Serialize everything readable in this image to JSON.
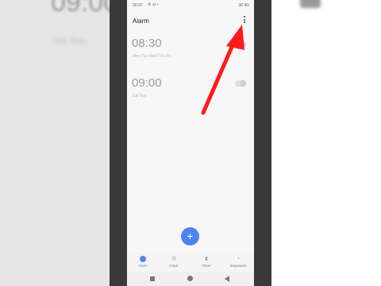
{
  "app": {
    "title": "Alarm"
  },
  "status_bar": {
    "time": "20:37",
    "right": "36 4G"
  },
  "alarms": [
    {
      "time": "08:30",
      "days": "Mon Tue Wed Thu Fri",
      "enabled": false
    },
    {
      "time": "09:00",
      "days": "Sat Sun",
      "enabled": false
    }
  ],
  "fab": {
    "label": "+"
  },
  "bottom_nav": [
    {
      "label": "Alarm",
      "active": true
    },
    {
      "label": "Clock",
      "active": false
    },
    {
      "label": "Timer",
      "active": false
    },
    {
      "label": "Stopwatch",
      "active": false
    }
  ],
  "background_ghost": {
    "time": "09:00",
    "days": "Sat Sun"
  },
  "colors": {
    "accent": "#4f82f0",
    "annotation_arrow": "#ff1a1a"
  }
}
